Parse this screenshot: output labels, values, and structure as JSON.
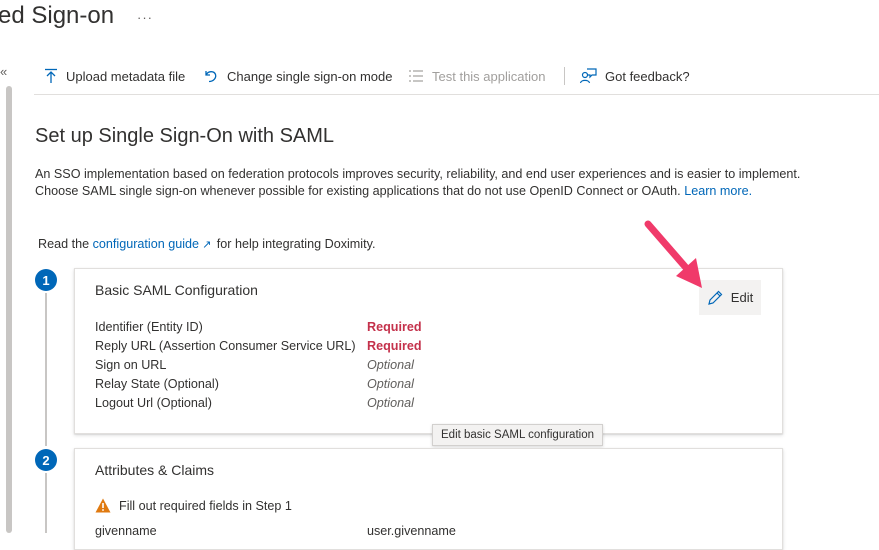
{
  "header": {
    "title": "ed Sign-on",
    "more": "···",
    "collapse": "«"
  },
  "toolbar": {
    "upload": "Upload metadata file",
    "change_mode": "Change single sign-on mode",
    "test": "Test this application",
    "feedback": "Got feedback?"
  },
  "main": {
    "title": "Set up Single Sign-On with SAML",
    "description": "An SSO implementation based on federation protocols improves security, reliability, and end user experiences and is easier to implement. Choose SAML single sign-on whenever possible for existing applications that do not use OpenID Connect or OAuth.",
    "learn_more": "Learn more.",
    "guide_prefix": "Read the",
    "guide_link": "configuration guide",
    "guide_suffix": "for help integrating Doximity."
  },
  "steps": [
    {
      "number": "1",
      "title": "Basic SAML Configuration",
      "edit_label": "Edit",
      "tooltip": "Edit basic SAML configuration",
      "rows": [
        {
          "label": "Identifier (Entity ID)",
          "value": "Required"
        },
        {
          "label": "Reply URL (Assertion Consumer Service URL)",
          "value": "Required"
        },
        {
          "label": "Sign on URL",
          "value": "Optional"
        },
        {
          "label": "Relay State (Optional)",
          "value": "Optional"
        },
        {
          "label": "Logout Url (Optional)",
          "value": "Optional"
        }
      ]
    },
    {
      "number": "2",
      "title": "Attributes & Claims",
      "warning": "Fill out required fields in Step 1",
      "rows": [
        {
          "label": "givenname",
          "value": "user.givenname"
        }
      ]
    }
  ],
  "colors": {
    "accent": "#0067b8",
    "required": "#c4314b",
    "arrow": "#f03a6a",
    "warning": "#e07a10"
  }
}
